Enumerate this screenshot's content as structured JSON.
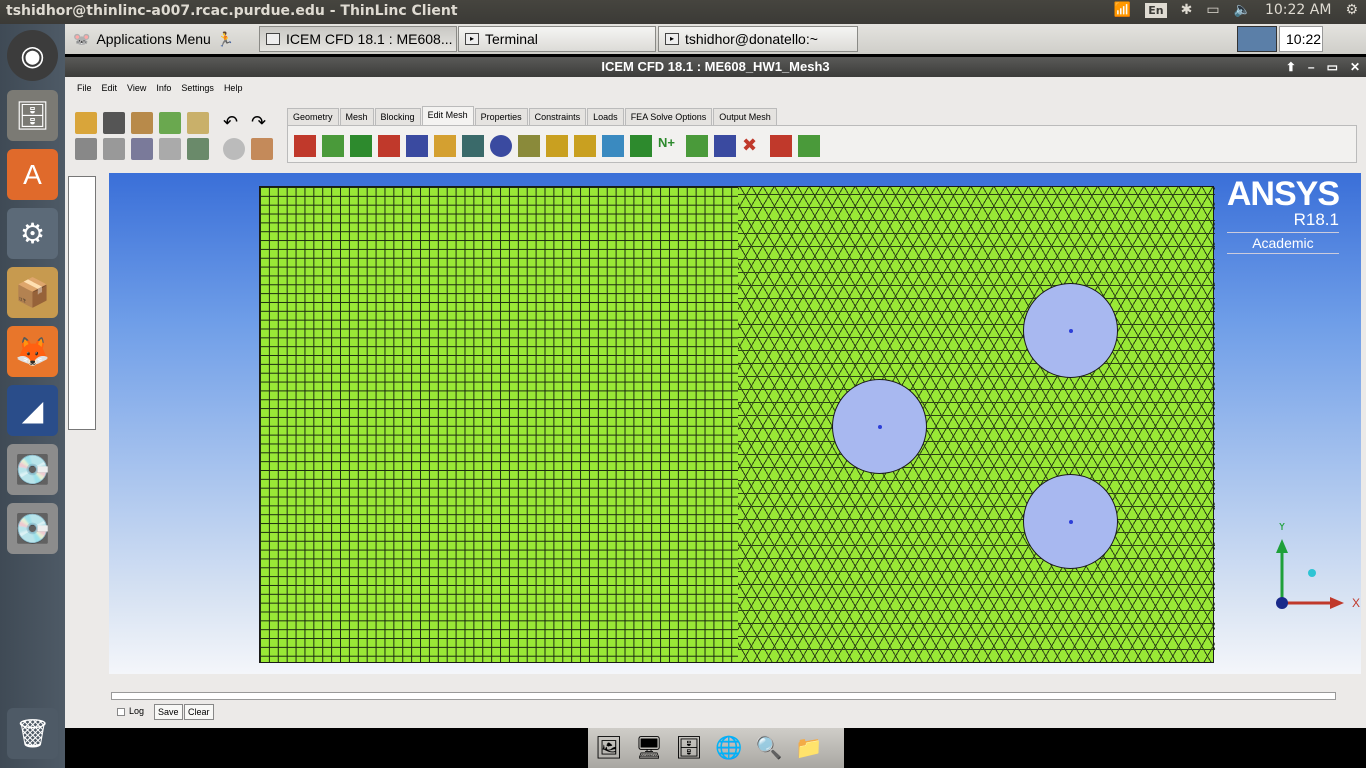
{
  "topbar": {
    "title": "tshidhor@thinlinc-a007.rcac.purdue.edu - ThinLinc Client",
    "kbd": "En",
    "clock": "10:22 AM"
  },
  "taskbar": {
    "apps_menu": "Applications Menu",
    "tasks": [
      "ICEM CFD 18.1 : ME608...",
      "Terminal",
      "tshidhor@donatello:~"
    ],
    "clock": "10:22"
  },
  "window": {
    "title": "ICEM CFD 18.1 : ME608_HW1_Mesh3",
    "menus": [
      "File",
      "Edit",
      "View",
      "Info",
      "Settings",
      "Help"
    ],
    "tabs": [
      "Geometry",
      "Mesh",
      "Blocking",
      "Edit Mesh",
      "Properties",
      "Constraints",
      "Loads",
      "FEA Solve Options",
      "Output Mesh"
    ],
    "selected_tab": "Edit Mesh"
  },
  "logo": {
    "brand": "ANSYS",
    "version": "R18.1",
    "edition": "Academic"
  },
  "axes": {
    "x": "X",
    "y": "Y"
  },
  "message": {
    "log": "Log",
    "save": "Save",
    "clear": "Clear"
  },
  "colors": {
    "mesh": "#99e836",
    "viewport_top": "#3a6fd8",
    "holes": "#a8b8f0"
  }
}
